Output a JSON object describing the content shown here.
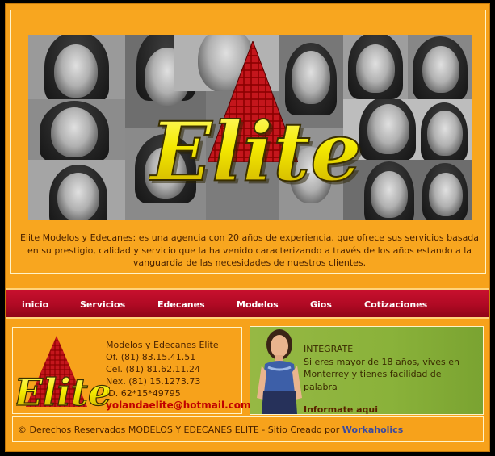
{
  "brand": {
    "logo_text": "Elite",
    "colors": {
      "primary": "#f7a21b",
      "nav": "#b00a24",
      "logo_yellow": "#f2e600",
      "accent_green": "#8ab23a",
      "email": "#c00000"
    }
  },
  "intro": {
    "text": "Elite Modelos y Edecanes: es una agencia con 20 años de experiencia. que ofrece sus servicios basada en su prestigio, calidad y servicio que la ha venido caracterizando a través de los años estando a la vanguardia de las necesidades de nuestros clientes."
  },
  "nav": {
    "items": [
      {
        "label": "inicio"
      },
      {
        "label": "Servicios"
      },
      {
        "label": "Edecanes"
      },
      {
        "label": "Modelos"
      },
      {
        "label": "Gios"
      },
      {
        "label": "Cotizaciones"
      }
    ]
  },
  "contact": {
    "title": "Modelos y Edecanes Elite",
    "office": "Of. (81) 83.15.41.51",
    "cell": "Cel. (81) 81.62.11.24",
    "nextel": "Nex. (81) 15.1273.73",
    "id": "ID. 62*15*49795",
    "email": "yolandaelite@hotmail.com"
  },
  "integrate": {
    "title": "INTEGRATE",
    "text": "Si eres mayor de 18 años, vives en Monterrey y tienes facilidad de palabra",
    "link": "Informate aqui"
  },
  "footer": {
    "text": "© Derechos Reservados MODELOS Y EDECANES ELITE - Sitio Creado por ",
    "link": "Workaholics"
  }
}
